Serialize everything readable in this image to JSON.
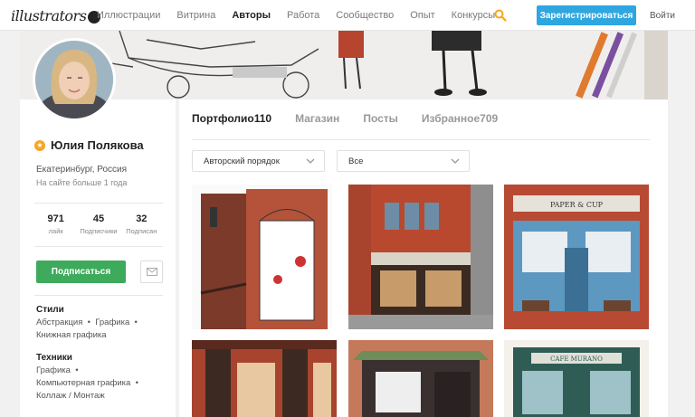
{
  "header": {
    "logo_text": "illustrators",
    "nav": [
      "Иллюстрации",
      "Витрина",
      "Авторы",
      "Работа",
      "Сообщество",
      "Опыт",
      "Конкурсы"
    ],
    "active_nav": "Авторы",
    "register_label": "Зарегистрироваться",
    "login_label": "Войти",
    "accent_color": "#2ea7e0",
    "search_icon_color": "#f5a623"
  },
  "profile": {
    "name": "Юлия Полякова",
    "location": "Екатеринбург, Россия",
    "member_since": "На сайте больше 1 года",
    "stats": [
      {
        "value": "971",
        "label": "лайк"
      },
      {
        "value": "45",
        "label": "Подписчики"
      },
      {
        "value": "32",
        "label": "Подписан"
      }
    ],
    "subscribe_label": "Подписаться",
    "subscribe_color": "#3daa5c",
    "styles_title": "Стили",
    "styles": [
      "Абстракция",
      "Графика",
      "Книжная графика"
    ],
    "techniques_title": "Техники",
    "techniques": [
      "Графика",
      "Компьютерная графика",
      "Коллаж / Монтаж"
    ]
  },
  "tabs": [
    {
      "label": "Портфолио",
      "count": "110"
    },
    {
      "label": "Магазин",
      "count": ""
    },
    {
      "label": "Посты",
      "count": ""
    },
    {
      "label": "Избранное",
      "count": "709"
    }
  ],
  "filters": {
    "sort_label": "Авторский порядок",
    "category_label": "Все"
  },
  "gallery": {
    "shop_sign_1": "PAPER & CUP",
    "shop_sign_2": "CAFE MURANO"
  }
}
